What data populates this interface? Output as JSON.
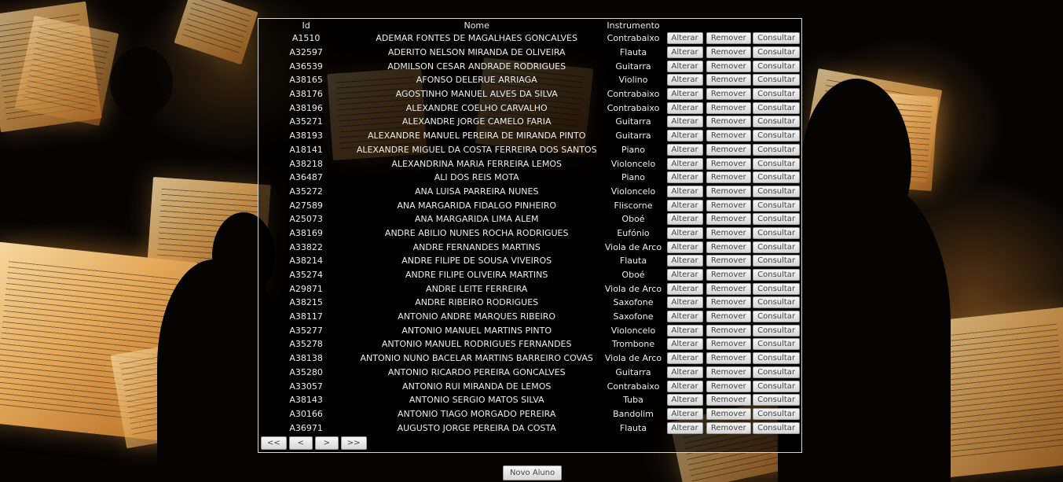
{
  "table": {
    "headers": {
      "id": "Id",
      "nome": "Nome",
      "instrumento": "Instrumento"
    },
    "action_labels": {
      "alterar": "Alterar",
      "remover": "Remover",
      "consultar": "Consultar"
    },
    "rows": [
      {
        "id": "A1510",
        "nome": "ADEMAR FONTES DE MAGALHAES GONCALVES",
        "instrumento": "Contrabaixo"
      },
      {
        "id": "A32597",
        "nome": "ADERITO NELSON MIRANDA DE OLIVEIRA",
        "instrumento": "Flauta"
      },
      {
        "id": "A36539",
        "nome": "ADMILSON CESAR ANDRADE RODRIGUES",
        "instrumento": "Guitarra"
      },
      {
        "id": "A38165",
        "nome": "AFONSO DELERUE ARRIAGA",
        "instrumento": "Violino"
      },
      {
        "id": "A38176",
        "nome": "AGOSTINHO MANUEL ALVES DA SILVA",
        "instrumento": "Contrabaixo"
      },
      {
        "id": "A38196",
        "nome": "ALEXANDRE COELHO CARVALHO",
        "instrumento": "Contrabaixo"
      },
      {
        "id": "A35271",
        "nome": "ALEXANDRE JORGE CAMELO FARIA",
        "instrumento": "Guitarra"
      },
      {
        "id": "A38193",
        "nome": "ALEXANDRE MANUEL PEREIRA DE MIRANDA PINTO",
        "instrumento": "Guitarra"
      },
      {
        "id": "A18141",
        "nome": "ALEXANDRE MIGUEL DA COSTA FERREIRA DOS SANTOS",
        "instrumento": "Piano"
      },
      {
        "id": "A38218",
        "nome": "ALEXANDRINA MARIA FERREIRA LEMOS",
        "instrumento": "Violoncelo"
      },
      {
        "id": "A36487",
        "nome": "ALI DOS REIS MOTA",
        "instrumento": "Piano"
      },
      {
        "id": "A35272",
        "nome": "ANA LUISA PARREIRA NUNES",
        "instrumento": "Violoncelo"
      },
      {
        "id": "A27589",
        "nome": "ANA MARGARIDA FIDALGO PINHEIRO",
        "instrumento": "Fliscorne"
      },
      {
        "id": "A25073",
        "nome": "ANA MARGARIDA LIMA ALEM",
        "instrumento": "Oboé"
      },
      {
        "id": "A38169",
        "nome": "ANDRE ABILIO NUNES ROCHA RODRIGUES",
        "instrumento": "Eufónio"
      },
      {
        "id": "A33822",
        "nome": "ANDRE FERNANDES MARTINS",
        "instrumento": "Viola de Arco"
      },
      {
        "id": "A38214",
        "nome": "ANDRE FILIPE DE SOUSA VIVEIROS",
        "instrumento": "Flauta"
      },
      {
        "id": "A35274",
        "nome": "ANDRE FILIPE OLIVEIRA MARTINS",
        "instrumento": "Oboé"
      },
      {
        "id": "A29871",
        "nome": "ANDRE LEITE FERREIRA",
        "instrumento": "Viola de Arco"
      },
      {
        "id": "A38215",
        "nome": "ANDRE RIBEIRO RODRIGUES",
        "instrumento": "Saxofone"
      },
      {
        "id": "A38117",
        "nome": "ANTONIO ANDRE MARQUES RIBEIRO",
        "instrumento": "Saxofone"
      },
      {
        "id": "A35277",
        "nome": "ANTONIO MANUEL MARTINS PINTO",
        "instrumento": "Violoncelo"
      },
      {
        "id": "A35278",
        "nome": "ANTONIO MANUEL RODRIGUES FERNANDES",
        "instrumento": "Trombone"
      },
      {
        "id": "A38138",
        "nome": "ANTONIO NUNO BACELAR MARTINS BARREIRO COVAS",
        "instrumento": "Viola de Arco"
      },
      {
        "id": "A35280",
        "nome": "ANTONIO RICARDO PEREIRA GONCALVES",
        "instrumento": "Guitarra"
      },
      {
        "id": "A33057",
        "nome": "ANTONIO RUI MIRANDA DE LEMOS",
        "instrumento": "Contrabaixo"
      },
      {
        "id": "A38143",
        "nome": "ANTONIO SERGIO MATOS SILVA",
        "instrumento": "Tuba"
      },
      {
        "id": "A30166",
        "nome": "ANTONIO TIAGO MORGADO PEREIRA",
        "instrumento": "Bandolim"
      },
      {
        "id": "A36971",
        "nome": "AUGUSTO JORGE PEREIRA DA COSTA",
        "instrumento": "Flauta"
      }
    ]
  },
  "pager": {
    "first": "<<",
    "prev": "<",
    "next": ">",
    "last": ">>"
  },
  "novo_aluno_label": "Novo Aluno"
}
